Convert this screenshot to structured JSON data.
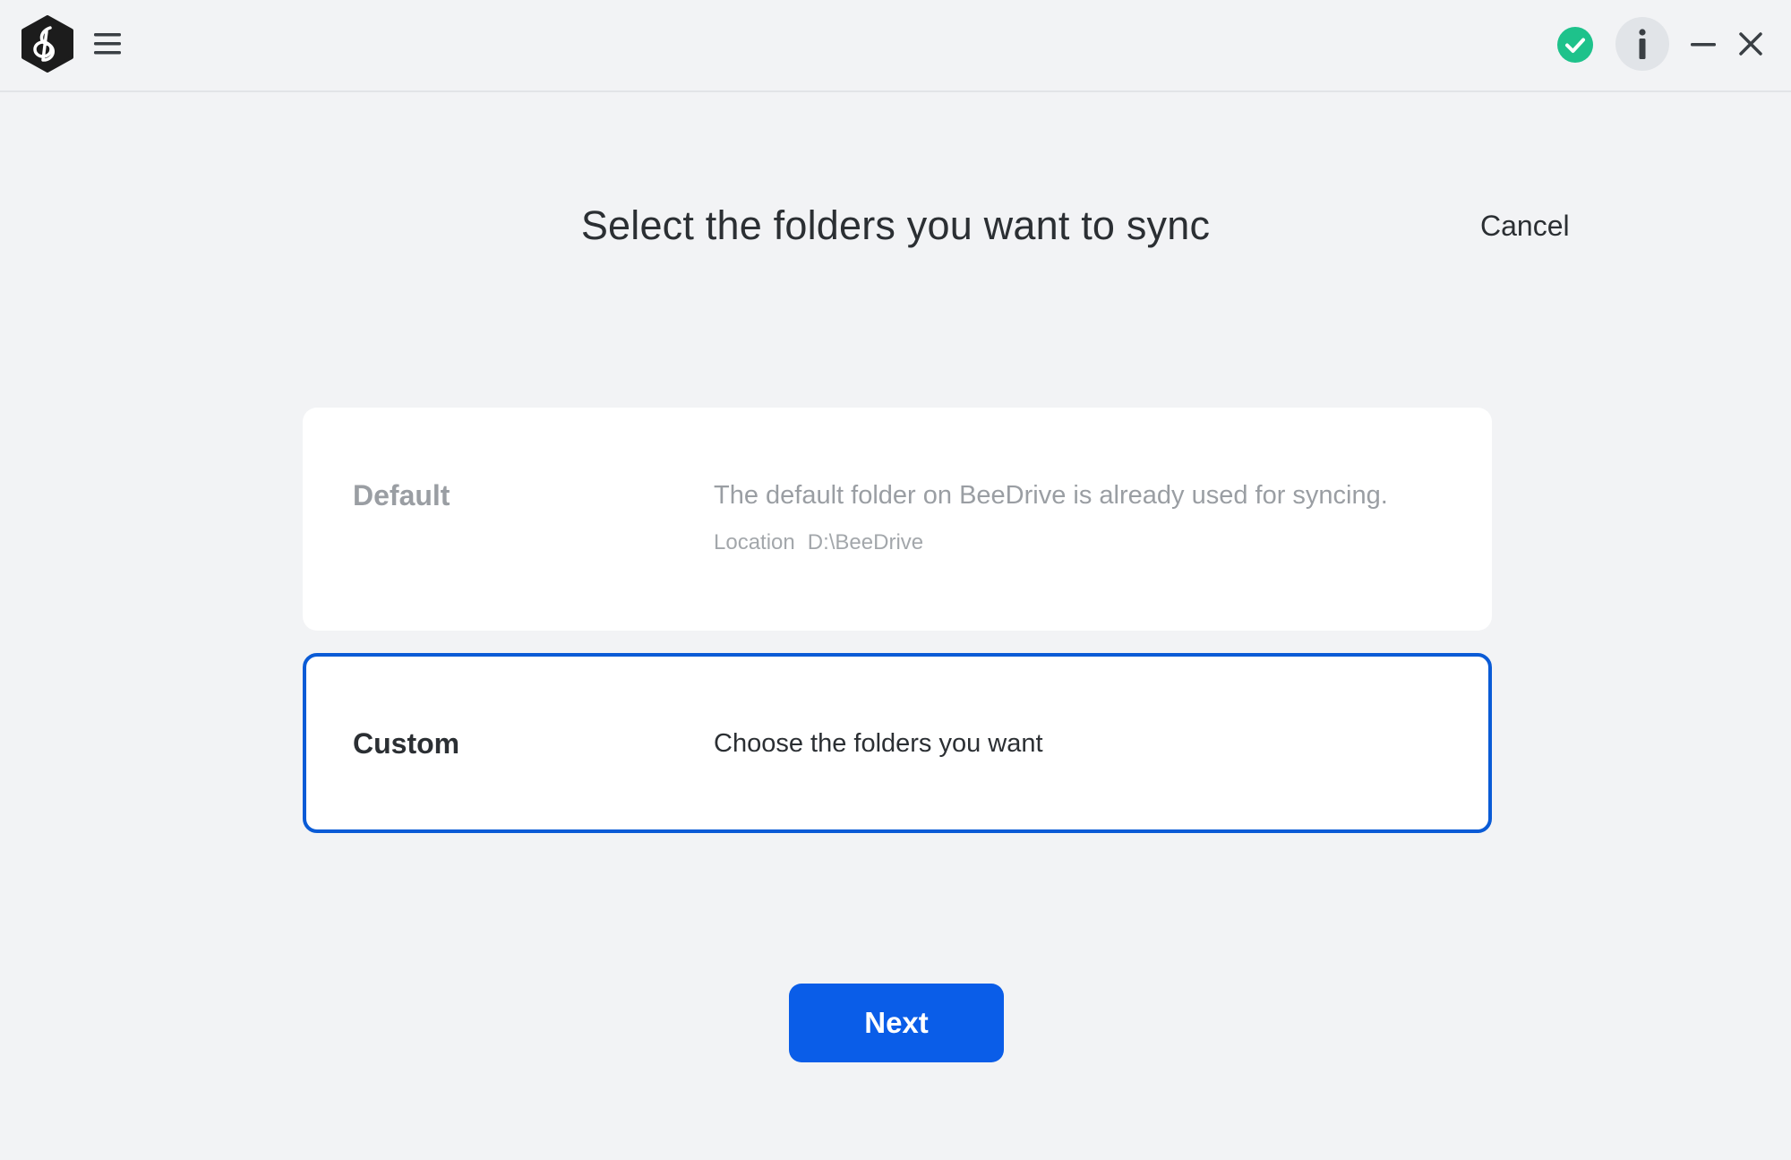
{
  "window": {
    "icons": {
      "logo": "beedrive-logo",
      "menu": "hamburger-menu-icon",
      "status": "check-circle-icon",
      "info": "info-icon",
      "minimize": "minimize-icon",
      "close": "close-icon"
    },
    "colors": {
      "status_ok": "#1ec28b",
      "accent": "#0a5de8",
      "selected_border": "#0a5bd6"
    }
  },
  "main": {
    "title": "Select the folders you want to sync",
    "cancel_label": "Cancel",
    "options": [
      {
        "label": "Default",
        "description": "The default folder on BeeDrive is already used for syncing.",
        "location_label": "Location",
        "location_value": "D:\\BeeDrive",
        "selected": false
      },
      {
        "label": "Custom",
        "description": "Choose the folders you want",
        "selected": true
      }
    ],
    "next_label": "Next"
  }
}
